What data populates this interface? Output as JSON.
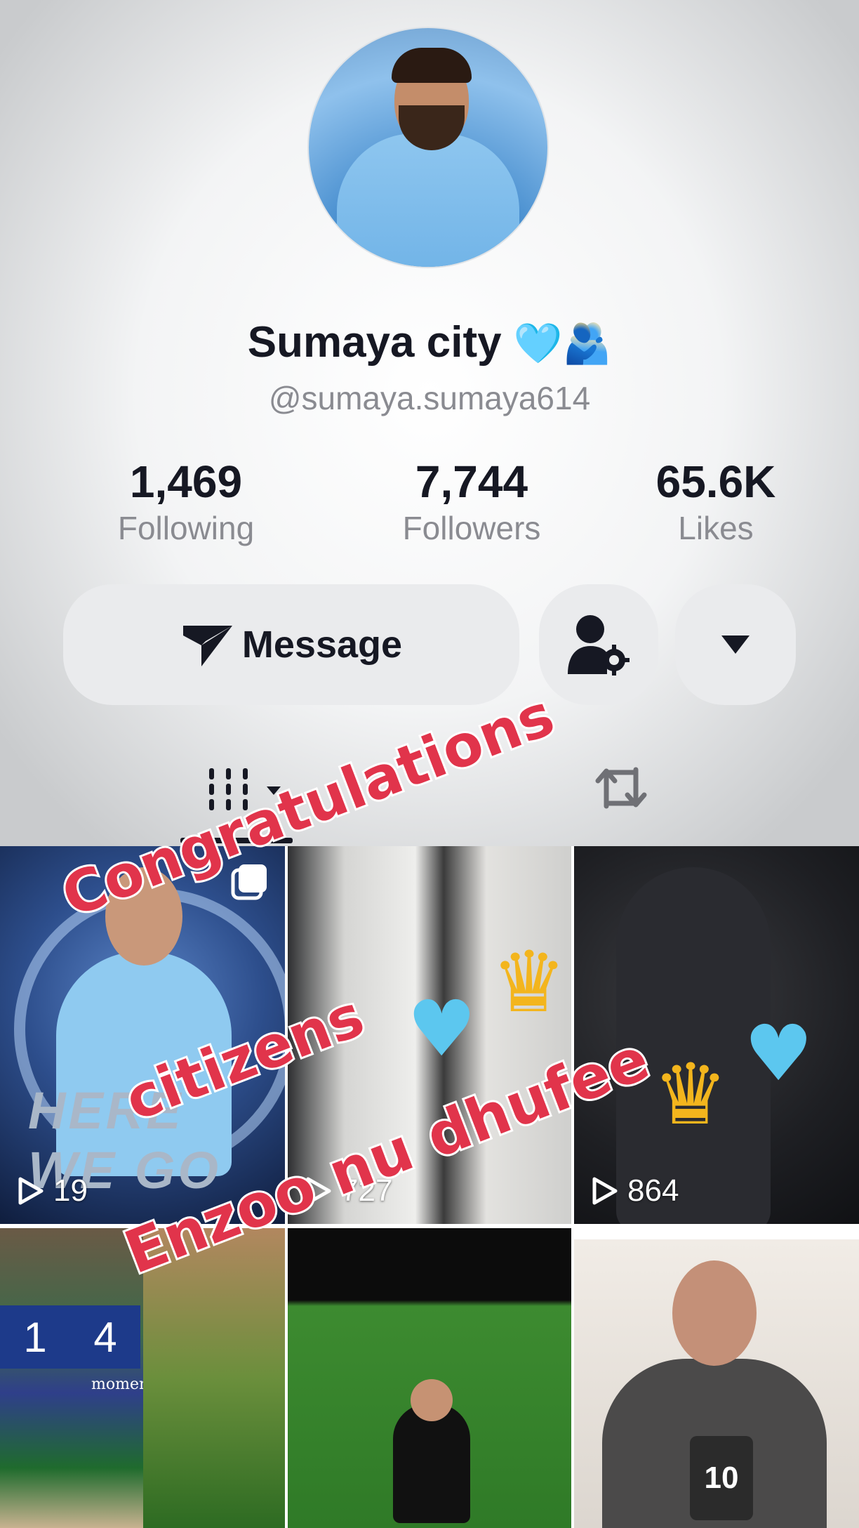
{
  "profile": {
    "display_name": "Sumaya city",
    "handle": "@sumaya.sumaya614",
    "name_emoji_1": "🩵",
    "name_emoji_2": "🫂"
  },
  "stats": [
    {
      "value": "1,469",
      "label": "Following"
    },
    {
      "value": "7,744",
      "label": "Followers"
    },
    {
      "value": "65.6K",
      "label": "Likes"
    }
  ],
  "actions": {
    "message_label": "Message"
  },
  "videos": [
    {
      "views": "19"
    },
    {
      "views": "727"
    },
    {
      "views": "864"
    }
  ],
  "tile_texts": {
    "tile1_caption": "HERE WE GO",
    "tile4_score_home": "1",
    "tile4_score_away": "4",
    "tile4_caption": "moments",
    "tile6_badge": "10"
  },
  "overlay_text": {
    "line1": "Congratulations",
    "line2": "citizens",
    "line3": "Enzoo nu dhufee"
  },
  "colors": {
    "overlay_text": "#e1344b",
    "primary_text": "#161823",
    "secondary_text": "#8a8b91",
    "button_bg": "#eaebed"
  }
}
